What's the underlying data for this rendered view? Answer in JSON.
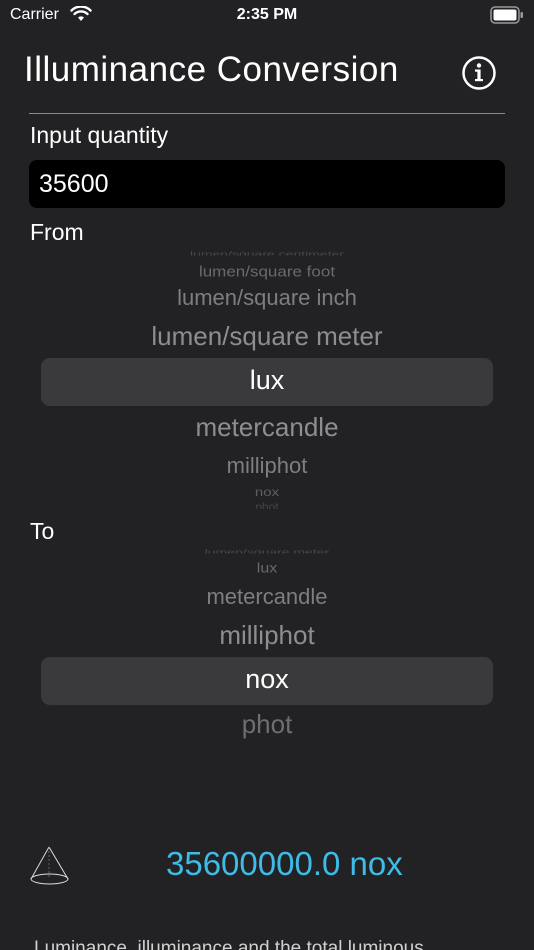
{
  "status_bar": {
    "carrier": "Carrier",
    "time": "2:35 PM"
  },
  "header": {
    "title": "Illuminance Conversion",
    "info_icon": "info-circle-icon"
  },
  "input": {
    "label": "Input quantity",
    "value": "35600"
  },
  "from_picker": {
    "label": "From",
    "options_above": [
      "lumen/square centimeter",
      "lumen/square foot",
      "lumen/square inch",
      "lumen/square meter"
    ],
    "selected": "lux",
    "options_below": [
      "metercandle",
      "milliphot",
      "nox",
      "phot"
    ]
  },
  "to_picker": {
    "label": "To",
    "options_above": [
      "lumen/square meter",
      "lux",
      "metercandle",
      "milliphot"
    ],
    "selected": "nox",
    "options_below": [
      "phot"
    ]
  },
  "result": {
    "icon": "cone-icon",
    "text": "35600000.0 nox",
    "color": "#3cbce6"
  },
  "footer": {
    "text": "Luminance, illuminance and the total luminous"
  }
}
